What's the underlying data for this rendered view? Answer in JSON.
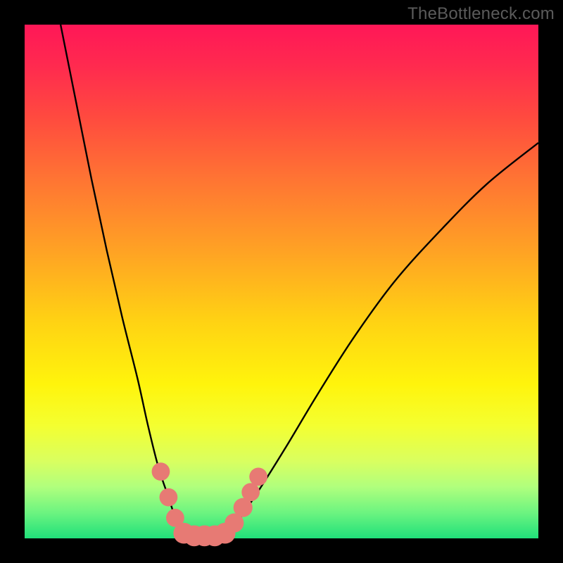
{
  "watermark": "TheBottleneck.com",
  "chart_data": {
    "type": "line",
    "title": "",
    "xlabel": "",
    "ylabel": "",
    "xlim": [
      0,
      100
    ],
    "ylim": [
      0,
      100
    ],
    "gradient_stops": [
      {
        "pos": 0,
        "color": "#ff1757"
      },
      {
        "pos": 8,
        "color": "#ff2a4f"
      },
      {
        "pos": 18,
        "color": "#ff4a3f"
      },
      {
        "pos": 30,
        "color": "#ff7433"
      },
      {
        "pos": 44,
        "color": "#ffa224"
      },
      {
        "pos": 58,
        "color": "#ffd313"
      },
      {
        "pos": 70,
        "color": "#fff40c"
      },
      {
        "pos": 78,
        "color": "#f4ff30"
      },
      {
        "pos": 85,
        "color": "#d9ff60"
      },
      {
        "pos": 90,
        "color": "#b0ff7d"
      },
      {
        "pos": 95,
        "color": "#6cf480"
      },
      {
        "pos": 100,
        "color": "#20e07a"
      }
    ],
    "series": [
      {
        "name": "left-branch",
        "x": [
          7,
          10,
          13,
          16,
          19,
          22,
          24,
          26,
          28,
          29.5,
          31
        ],
        "y": [
          100,
          85,
          70,
          56,
          43,
          31,
          22,
          14,
          8,
          3.5,
          0
        ]
      },
      {
        "name": "valley-floor",
        "x": [
          31,
          33,
          35,
          37,
          39
        ],
        "y": [
          0,
          0,
          0,
          0,
          0
        ]
      },
      {
        "name": "right-branch",
        "x": [
          39,
          42,
          46,
          51,
          57,
          64,
          72,
          81,
          90,
          100
        ],
        "y": [
          0,
          4,
          10,
          18,
          28,
          39,
          50,
          60,
          69,
          77
        ]
      }
    ],
    "markers": {
      "name": "highlight-dots",
      "color": "#e77a74",
      "points": [
        {
          "x": 26.5,
          "y": 13,
          "r": 1.2
        },
        {
          "x": 28.0,
          "y": 8,
          "r": 1.2
        },
        {
          "x": 29.3,
          "y": 4,
          "r": 1.2
        },
        {
          "x": 31.0,
          "y": 1,
          "r": 1.5
        },
        {
          "x": 33.0,
          "y": 0.5,
          "r": 1.5
        },
        {
          "x": 35.0,
          "y": 0.5,
          "r": 1.5
        },
        {
          "x": 37.0,
          "y": 0.5,
          "r": 1.5
        },
        {
          "x": 39.0,
          "y": 1,
          "r": 1.5
        },
        {
          "x": 40.8,
          "y": 3,
          "r": 1.3
        },
        {
          "x": 42.5,
          "y": 6,
          "r": 1.3
        },
        {
          "x": 44.0,
          "y": 9,
          "r": 1.2
        },
        {
          "x": 45.5,
          "y": 12,
          "r": 1.2
        }
      ]
    }
  }
}
